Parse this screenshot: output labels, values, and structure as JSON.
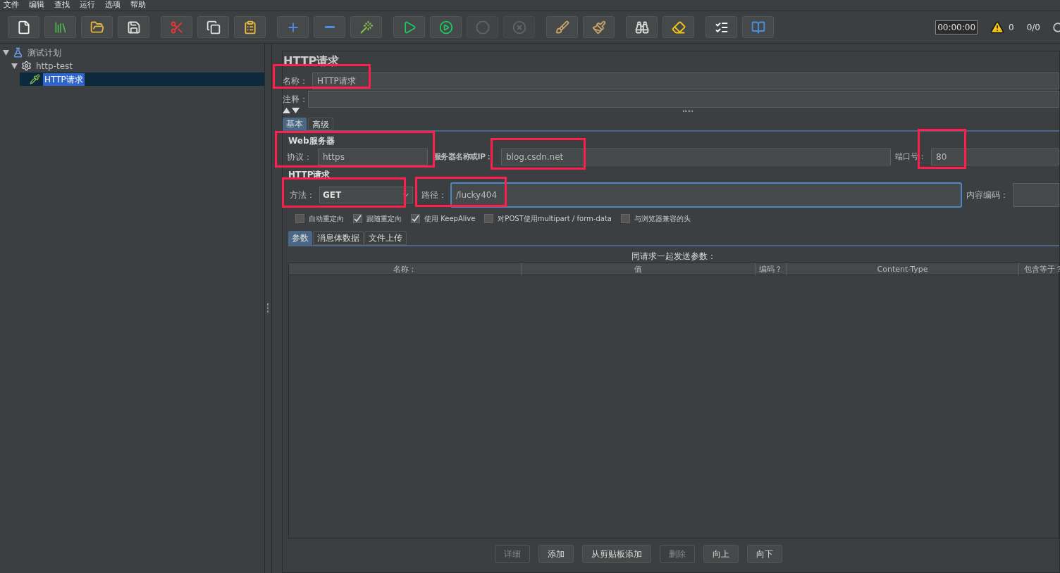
{
  "menu": [
    "文件",
    "编辑",
    "查找",
    "运行",
    "选项",
    "帮助"
  ],
  "toolbar": [
    {
      "kind": "new",
      "disabled": false
    },
    {
      "kind": "templates",
      "disabled": false
    },
    {
      "kind": "open",
      "disabled": false
    },
    {
      "kind": "save",
      "disabled": false
    },
    {
      "kind": "cut",
      "disabled": false
    },
    {
      "kind": "copy",
      "disabled": false
    },
    {
      "kind": "paste",
      "disabled": false
    },
    {
      "kind": "expand",
      "disabled": false
    },
    {
      "kind": "collapse",
      "disabled": false
    },
    {
      "kind": "toggle",
      "disabled": false
    },
    {
      "kind": "start",
      "disabled": false
    },
    {
      "kind": "start-no-pause",
      "disabled": false
    },
    {
      "kind": "stop",
      "disabled": true
    },
    {
      "kind": "shutdown",
      "disabled": true
    },
    {
      "kind": "clear",
      "disabled": false
    },
    {
      "kind": "clear-all",
      "disabled": false
    },
    {
      "kind": "search",
      "disabled": false
    },
    {
      "kind": "reset-search",
      "disabled": false
    },
    {
      "kind": "function-helper",
      "disabled": false
    },
    {
      "kind": "help",
      "disabled": false
    }
  ],
  "status": {
    "timer": "00:00:00",
    "warnings": "0",
    "threads": "0/0"
  },
  "tree": [
    {
      "label": "测试计划",
      "kind": "plan",
      "selected": false,
      "expanded": true,
      "children": [
        {
          "label": "http-test",
          "kind": "thread-group",
          "selected": false,
          "expanded": true,
          "children": [
            {
              "label": "HTTP请求",
              "kind": "sampler",
              "selected": true
            }
          ]
        }
      ]
    }
  ],
  "panel": {
    "title": "HTTP请求",
    "name": {
      "label": "名称：",
      "value": "HTTP请求",
      "highlighted": true
    },
    "comment": {
      "label": "注释："
    },
    "tabs": [
      {
        "label": "基本",
        "selected": true
      },
      {
        "label": "高级",
        "selected": false
      }
    ],
    "web_server": {
      "title": "Web服务器",
      "protocol": {
        "label": "协议：",
        "value": "https",
        "highlighted": true
      },
      "server": {
        "label": "服务器名称或IP：",
        "value": "blog.csdn.net",
        "highlighted": true
      },
      "port": {
        "label": "端口号：",
        "value": "80",
        "highlighted": true
      }
    },
    "http_request": {
      "title": "HTTP请求",
      "method": {
        "label": "方法：",
        "value": "GET",
        "highlighted": true
      },
      "path": {
        "label": "路径：",
        "value": "/lucky404",
        "highlighted": true
      },
      "encoding": {
        "label": "内容编码："
      }
    },
    "options": [
      {
        "label": "自动重定向",
        "checked": false
      },
      {
        "label": "跟随重定向",
        "checked": true
      },
      {
        "label": "使用 KeepAlive",
        "checked": true
      },
      {
        "label": "对POST使用multipart / form-data",
        "checked": false
      },
      {
        "label": "与浏览器兼容的头",
        "checked": false
      }
    ],
    "sub_tabs": [
      {
        "label": "参数",
        "selected": true
      },
      {
        "label": "消息体数据",
        "selected": false
      },
      {
        "label": "文件上传",
        "selected": false
      }
    ],
    "table": {
      "caption": "同请求一起发送参数：",
      "columns": [
        "名称：",
        "值",
        "编码？",
        "Content-Type",
        "包含等于？"
      ]
    },
    "buttons": [
      {
        "label": "详细",
        "disabled": true
      },
      {
        "label": "添加",
        "disabled": false
      },
      {
        "label": "从剪贴板添加",
        "disabled": false
      },
      {
        "label": "删除",
        "disabled": true
      },
      {
        "label": "向上",
        "disabled": false
      },
      {
        "label": "向下",
        "disabled": false
      }
    ]
  }
}
